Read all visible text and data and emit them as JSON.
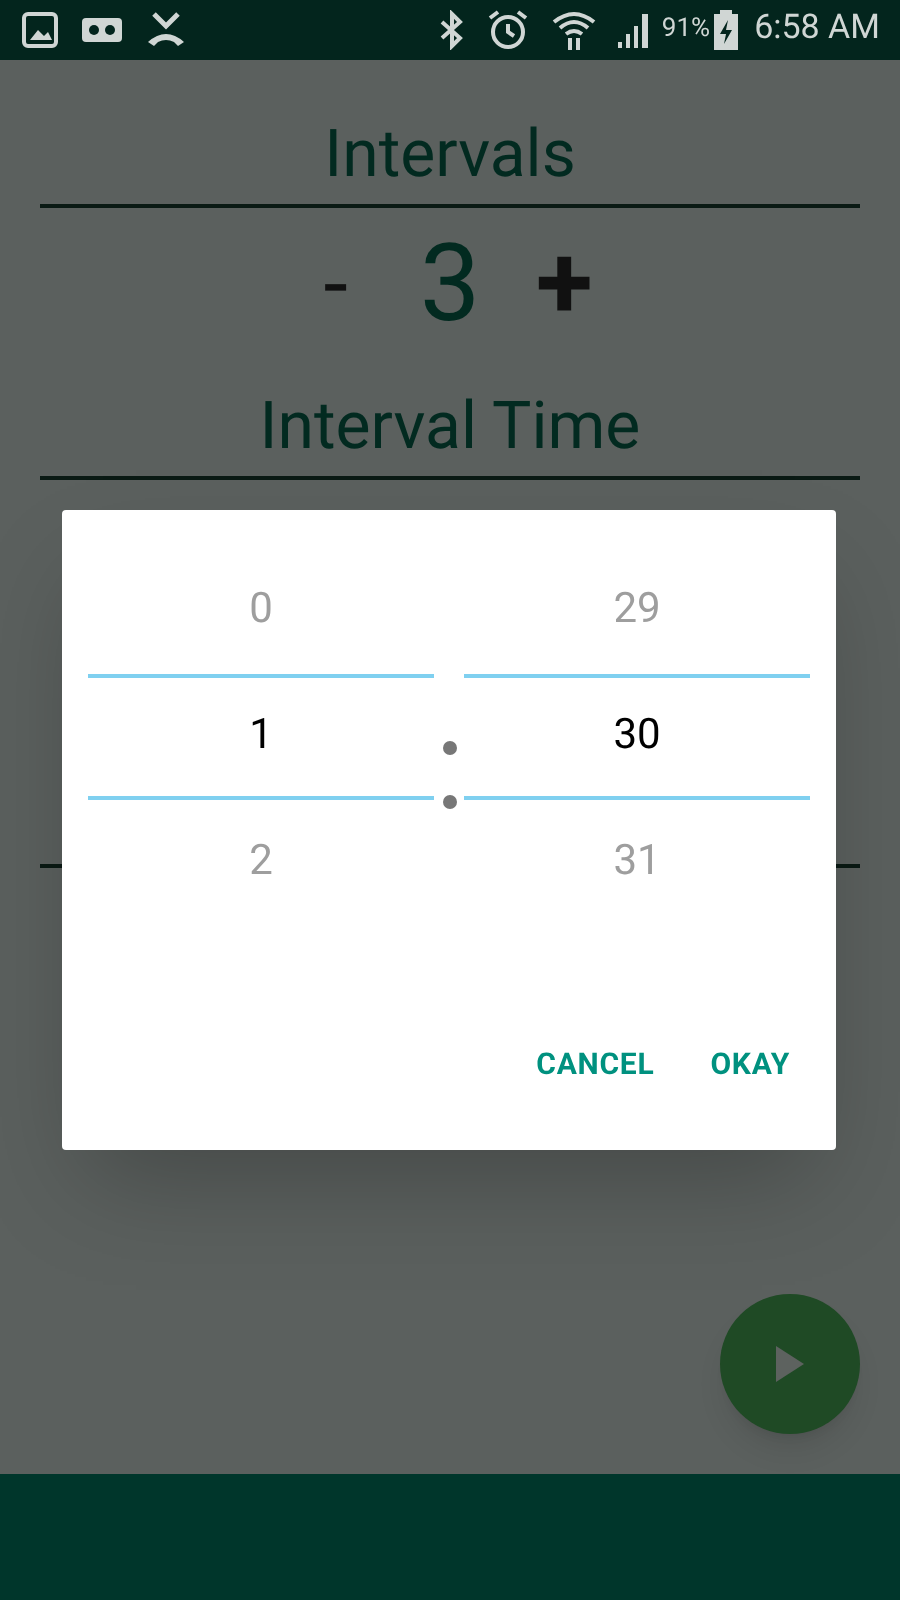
{
  "status_bar": {
    "battery": "91%",
    "time": "6:58 AM"
  },
  "intervals": {
    "title": "Intervals",
    "decrement": "-",
    "value": "3",
    "increment": "+"
  },
  "interval_time": {
    "title": "Interval Time"
  },
  "dialog": {
    "columns": [
      {
        "items": [
          {
            "value": "0",
            "selected": false
          },
          {
            "value": "1",
            "selected": true
          },
          {
            "value": "2",
            "selected": false
          }
        ]
      },
      {
        "items": [
          {
            "value": "29",
            "selected": false
          },
          {
            "value": "30",
            "selected": true
          },
          {
            "value": "31",
            "selected": false
          }
        ]
      }
    ],
    "buttons": [
      "CANCEL",
      "OKAY"
    ]
  }
}
